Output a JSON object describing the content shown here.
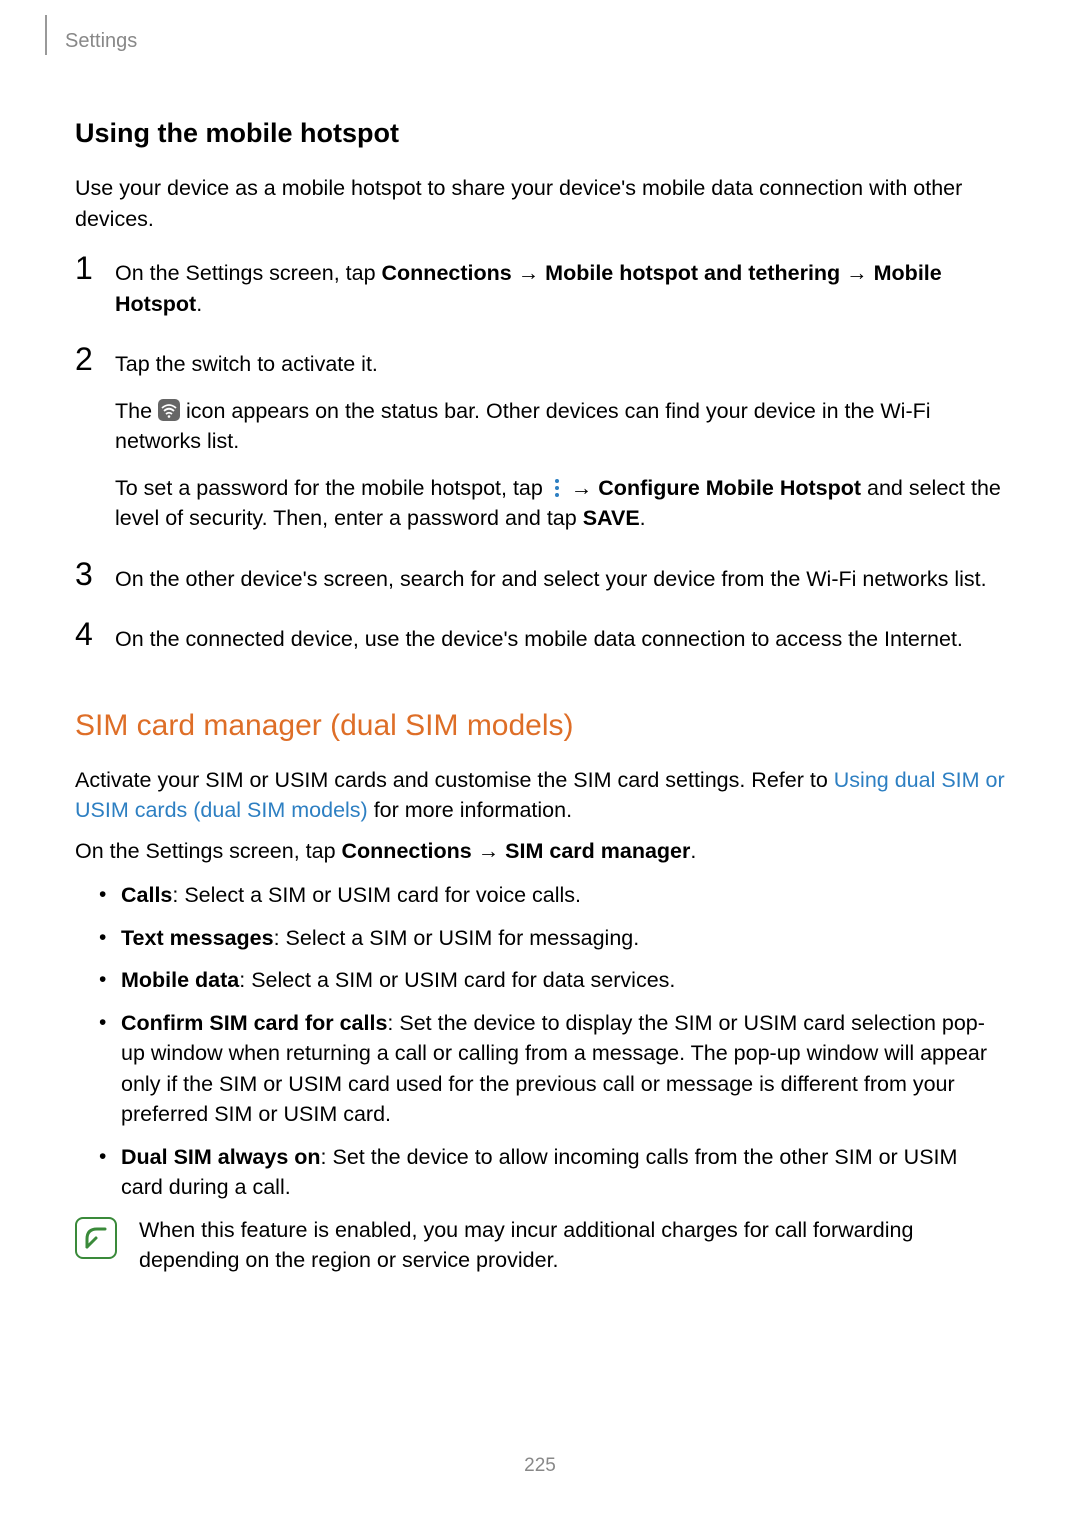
{
  "breadcrumb": "Settings",
  "heading1": "Using the mobile hotspot",
  "intro1": "Use your device as a mobile hotspot to share your device's mobile data connection with other devices.",
  "steps": [
    {
      "num": "1",
      "parts": {
        "p1": "On the Settings screen, tap ",
        "b1": "Connections",
        "arrow1": " → ",
        "b2": "Mobile hotspot and tethering",
        "arrow2": " → ",
        "b3": "Mobile Hotspot",
        "p2": "."
      }
    },
    {
      "num": "2",
      "main": "Tap the switch to activate it.",
      "sub1": {
        "p1": "The ",
        "p2": " icon appears on the status bar. Other devices can find your device in the Wi-Fi networks list."
      },
      "sub2": {
        "p1": "To set a password for the mobile hotspot, tap ",
        "arrow": " → ",
        "b1": "Configure Mobile Hotspot",
        "p2": " and select the level of security. Then, enter a password and tap ",
        "b2": "SAVE",
        "p3": "."
      }
    },
    {
      "num": "3",
      "main": "On the other device's screen, search for and select your device from the Wi-Fi networks list."
    },
    {
      "num": "4",
      "main": "On the connected device, use the device's mobile data connection to access the Internet."
    }
  ],
  "heading2": "SIM card manager (dual SIM models)",
  "section2": {
    "p1a": "Activate your SIM or USIM cards and customise the SIM card settings. Refer to ",
    "link1": "Using dual SIM or USIM cards (dual SIM models)",
    "p1b": " for more information.",
    "p2a": "On the Settings screen, tap ",
    "b1": "Connections",
    "arrow": " → ",
    "b2": "SIM card manager",
    "p2b": "."
  },
  "bullets": [
    {
      "b": "Calls",
      "t": ": Select a SIM or USIM card for voice calls."
    },
    {
      "b": "Text messages",
      "t": ": Select a SIM or USIM for messaging."
    },
    {
      "b": "Mobile data",
      "t": ": Select a SIM or USIM card for data services."
    },
    {
      "b": "Confirm SIM card for calls",
      "t": ": Set the device to display the SIM or USIM card selection pop-up window when returning a call or calling from a message. The pop-up window will appear only if the SIM or USIM card used for the previous call or message is different from your preferred SIM or USIM card."
    },
    {
      "b": "Dual SIM always on",
      "t": ": Set the device to allow incoming calls from the other SIM or USIM card during a call."
    }
  ],
  "note": "When this feature is enabled, you may incur additional charges for call forwarding depending on the region or service provider.",
  "pageNum": "225"
}
